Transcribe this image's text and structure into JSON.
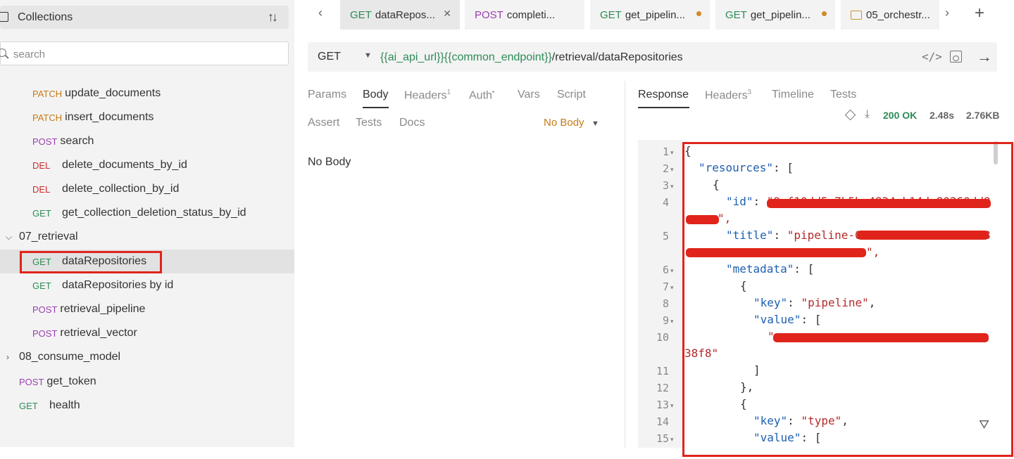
{
  "sidebar": {
    "title": "Collections",
    "search_placeholder": "search",
    "items": [
      {
        "method": "PATCH",
        "label": "update_documents"
      },
      {
        "method": "PATCH",
        "label": "insert_documents"
      },
      {
        "method": "POST",
        "label": "search"
      },
      {
        "method": "DEL",
        "label": "delete_documents_by_id"
      },
      {
        "method": "DEL",
        "label": "delete_collection_by_id"
      },
      {
        "method": "GET",
        "label": "get_collection_deletion_status_by_id"
      },
      {
        "folder": "07_retrieval"
      },
      {
        "method": "GET",
        "label": "dataRepositories"
      },
      {
        "method": "GET",
        "label": "dataRepositories by id"
      },
      {
        "method": "POST",
        "label": "retrieval_pipeline"
      },
      {
        "method": "POST",
        "label": "retrieval_vector"
      },
      {
        "folder": "08_consume_model"
      },
      {
        "method": "POST",
        "label": "get_token"
      },
      {
        "method": "GET",
        "label": "health"
      }
    ]
  },
  "tabs": [
    {
      "method": "GET",
      "label": "dataRepos..."
    },
    {
      "method": "POST",
      "label": "completi..."
    },
    {
      "method": "GET",
      "label": "get_pipelin..."
    },
    {
      "method": "GET",
      "label": "get_pipelin..."
    },
    {
      "method": "",
      "label": "05_orchestr..."
    }
  ],
  "request": {
    "method": "GET",
    "url_var1": "{{ai_api_url}}",
    "url_var2": "{{common_endpoint}}",
    "url_path": "/retrieval/dataRepositories",
    "tabs_row1": [
      "Params",
      "Body",
      "Headers",
      "Auth",
      "Vars",
      "Script"
    ],
    "headers_count": "1",
    "auth_marker": "•",
    "tabs_row2": [
      "Assert",
      "Tests",
      "Docs"
    ],
    "body_mode": "No Body",
    "body_text": "No Body"
  },
  "response": {
    "tabs": [
      "Response",
      "Headers",
      "Timeline",
      "Tests"
    ],
    "headers_count": "3",
    "status": "200 OK",
    "time": "2.48s",
    "size": "2.76KB",
    "line_numbers": [
      "1",
      "2",
      "3",
      "4",
      "5",
      "6",
      "7",
      "8",
      "9",
      "10",
      "11",
      "12",
      "13",
      "14",
      "15"
    ],
    "code": {
      "l1": "{",
      "l2_key": "\"resources\"",
      "l2_rest": ": [",
      "l3": "{",
      "l4_key": "\"id\"",
      "l4_val": "\"9ef10dd5-7b5b-4834-b14d-80260dd9",
      "l4b": "\",",
      "l5_key": "\"title\"",
      "l5_val": "\"pipeline-05e8ccfd-9134-499d-8",
      "l5b": "\",",
      "l6_key": "\"metadata\"",
      "l6_rest": ": [",
      "l7": "{",
      "l8_key": "\"key\"",
      "l8_val": "\"pipeline\"",
      "l9_key": "\"value\"",
      "l9_rest": ": [",
      "l10_val": "\"",
      "l10b": "38f8\"",
      "l11": "]",
      "l12": "},",
      "l13": "{",
      "l14_key": "\"key\"",
      "l14_val": "\"type\"",
      "l15_key": "\"value\"",
      "l15_rest": ": ["
    }
  },
  "colors": {
    "get": "#2e8b57",
    "post": "#9b3fb0",
    "patch": "#c77a16",
    "del": "#d12a2a",
    "annotation": "#e0241b"
  }
}
